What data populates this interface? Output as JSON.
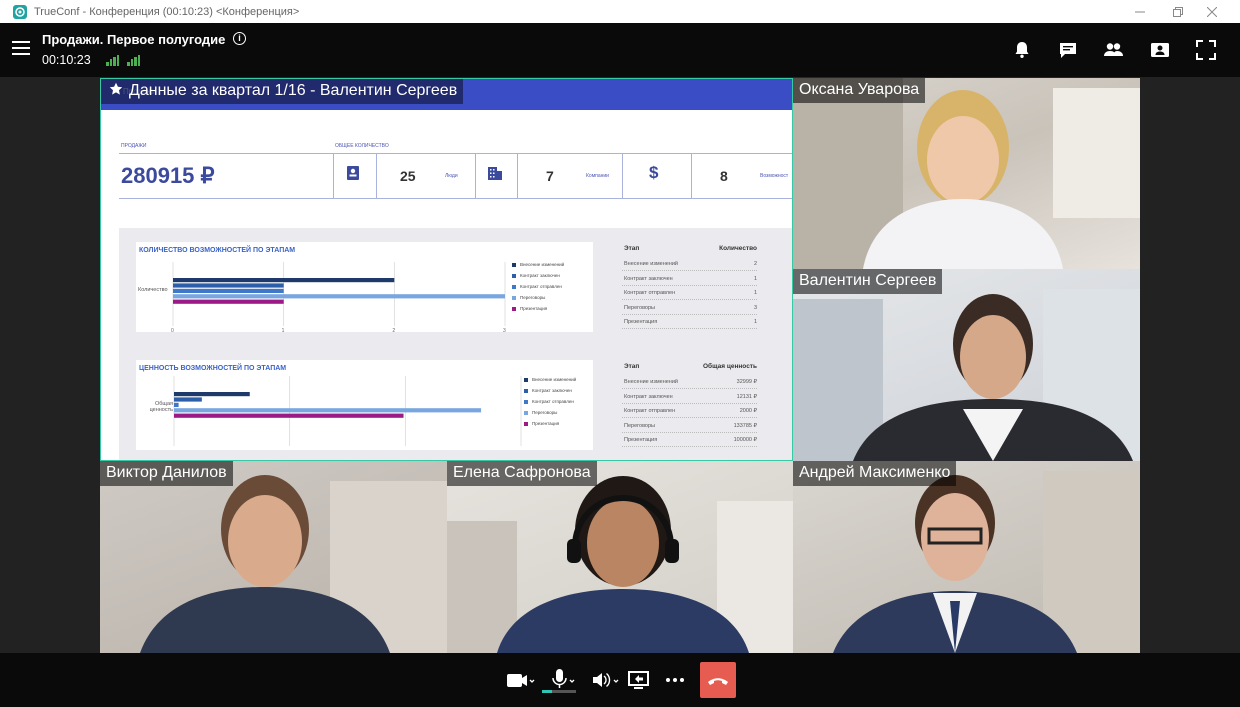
{
  "window": {
    "title": "TrueConf - Конференция (00:10:23) <Конференция>"
  },
  "header": {
    "conference_title": "Продажи. Первое полугодие",
    "timer": "00:10:23",
    "info_icon": "info-icon",
    "icons": [
      "bell-icon",
      "chat-icon",
      "participants-icon",
      "layout-icon",
      "fullscreen-icon"
    ]
  },
  "share": {
    "label": "Данные за квартал 1/16 - Валентин Сергеев",
    "faded_text": "Продажи",
    "kpi": {
      "sales_label": "ПРОДАЖИ",
      "sales_value": "280915 ₽",
      "total_label": "ОБЩЕЕ КОЛИЧЕСТВО",
      "people_value": "25",
      "people_unit": "Люди",
      "companies_value": "7",
      "companies_unit": "Компании",
      "opps_value": "8",
      "opps_unit": "Возможност"
    },
    "chart1": {
      "title": "КОЛИЧЕСТВО ВОЗМОЖНОСТЕЙ ПО ЭТАПАМ",
      "category_label": "Количество",
      "ticks": [
        "0",
        "1",
        "2",
        "3"
      ]
    },
    "chart2": {
      "title": "ЦЕННОСТЬ ВОЗМОЖНОСТЕЙ ПО ЭТАПАМ",
      "category_label_1": "Общая",
      "category_label_2": "ценность"
    },
    "table1": {
      "col1": "Этап",
      "col2": "Количество",
      "rows": [
        {
          "stage": "Внесение изменений",
          "value": "2"
        },
        {
          "stage": "Контракт заключен",
          "value": "1"
        },
        {
          "stage": "Контракт отправлен",
          "value": "1"
        },
        {
          "stage": "Переговоры",
          "value": "3"
        },
        {
          "stage": "Презентация",
          "value": "1"
        }
      ]
    },
    "table2": {
      "col1": "Этап",
      "col2": "Общая ценность",
      "rows": [
        {
          "stage": "Внесение изменений",
          "value": "32999 ₽"
        },
        {
          "stage": "Контракт заключен",
          "value": "12131 ₽"
        },
        {
          "stage": "Контракт отправлен",
          "value": "2000 ₽"
        },
        {
          "stage": "Переговоры",
          "value": "133785 ₽"
        },
        {
          "stage": "Презентация",
          "value": "100000 ₽"
        }
      ]
    },
    "legend": [
      "Внесение изменений",
      "Контракт заключен",
      "Контракт отправлен",
      "Переговоры",
      "Презентация"
    ],
    "legend_colors": [
      "#1d3a6b",
      "#2d5ea8",
      "#3f78c9",
      "#7aa6e0",
      "#9c1a86"
    ]
  },
  "chart_data": [
    {
      "type": "bar",
      "title": "КОЛИЧЕСТВО ВОЗМОЖНОСТЕЙ ПО ЭТАПАМ",
      "categories": [
        "Количество"
      ],
      "xlim": [
        0,
        3
      ],
      "series": [
        {
          "name": "Внесение изменений",
          "values": [
            2
          ]
        },
        {
          "name": "Контракт заключен",
          "values": [
            1
          ]
        },
        {
          "name": "Контракт отправлен",
          "values": [
            1
          ]
        },
        {
          "name": "Переговоры",
          "values": [
            3
          ]
        },
        {
          "name": "Презентация",
          "values": [
            1
          ]
        }
      ]
    },
    {
      "type": "bar",
      "title": "ЦЕННОСТЬ ВОЗМОЖНОСТЕЙ ПО ЭТАПАМ",
      "categories": [
        "Общая ценность"
      ],
      "series": [
        {
          "name": "Внесение изменений",
          "values": [
            32999
          ]
        },
        {
          "name": "Контракт заключен",
          "values": [
            12131
          ]
        },
        {
          "name": "Контракт отправлен",
          "values": [
            2000
          ]
        },
        {
          "name": "Переговоры",
          "values": [
            133785
          ]
        },
        {
          "name": "Презентация",
          "values": [
            100000
          ]
        }
      ]
    }
  ],
  "participants": {
    "p1": "Оксана Уварова",
    "p2": "Валентин Сергеев",
    "p3": "Виктор Данилов",
    "p4": "Елена Сафронова",
    "p5": "Андрей Максименко"
  },
  "controls": {
    "icons": [
      "camera-icon",
      "microphone-icon",
      "speaker-icon",
      "screen-share-icon",
      "more-icon",
      "hangup-icon"
    ],
    "hangup_color": "#e65c50"
  },
  "colors": {
    "accent": "#3b4dc5",
    "active_border": "#35c9a4",
    "signal": "#4caf50"
  }
}
